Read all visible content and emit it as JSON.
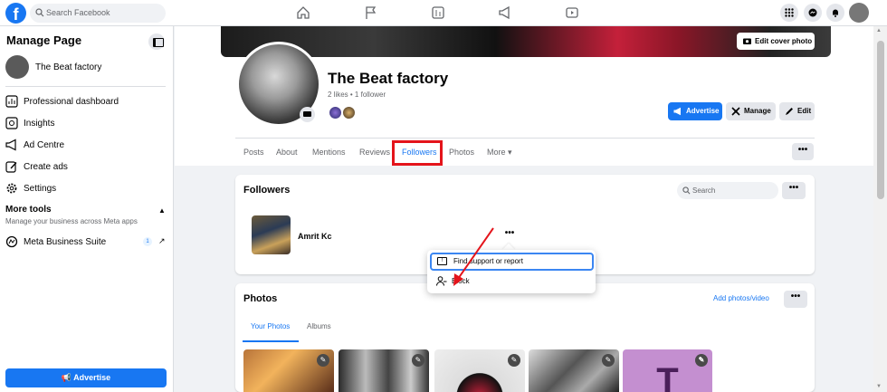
{
  "topbar": {
    "logo": "f",
    "search_placeholder": "Search Facebook",
    "nav_icons": [
      "home-icon",
      "flag-icon",
      "pages-icon",
      "megaphone-icon",
      "watch-icon"
    ],
    "right_icons": [
      "menu-grid-icon",
      "messenger-icon",
      "notifications-icon",
      "account-avatar"
    ]
  },
  "sidebar": {
    "title": "Manage Page",
    "page_name": "The Beat factory",
    "items": [
      {
        "label": "Professional dashboard",
        "icon": "dashboard-icon"
      },
      {
        "label": "Insights",
        "icon": "insights-icon"
      },
      {
        "label": "Ad Centre",
        "icon": "megaphone-icon"
      },
      {
        "label": "Create ads",
        "icon": "pencil-icon"
      },
      {
        "label": "Settings",
        "icon": "gear-icon"
      }
    ],
    "more_tools": "More tools",
    "more_tools_sub": "Manage your business across Meta apps",
    "meta_business": "Meta Business Suite",
    "meta_badge": "1",
    "advertise": "Advertise"
  },
  "profile": {
    "edit_cover": "Edit cover photo",
    "name": "The Beat factory",
    "stats": "2 likes • 1 follower",
    "buttons": {
      "advertise": "Advertise",
      "manage": "Manage",
      "edit": "Edit"
    }
  },
  "tabs": [
    {
      "label": "Posts"
    },
    {
      "label": "About"
    },
    {
      "label": "Mentions"
    },
    {
      "label": "Reviews"
    },
    {
      "label": "Followers",
      "active": true
    },
    {
      "label": "Photos"
    },
    {
      "label": "More ▾"
    }
  ],
  "tab_more": "•••",
  "followers_card": {
    "title": "Followers",
    "search_placeholder": "Search",
    "dots": "•••",
    "follower": {
      "name": "Amrit Kc",
      "dots": "•••"
    }
  },
  "context_menu": {
    "item1": "Find support or report",
    "item1_icon": "!",
    "item2": "Block"
  },
  "photos_card": {
    "title": "Photos",
    "add": "Add photos/video",
    "dots": "•••",
    "tabs": [
      "Your Photos",
      "Albums"
    ],
    "pen": "✎",
    "letter": "T"
  },
  "colors": {
    "accent": "#1877f2",
    "highlight": "#e4141b"
  }
}
